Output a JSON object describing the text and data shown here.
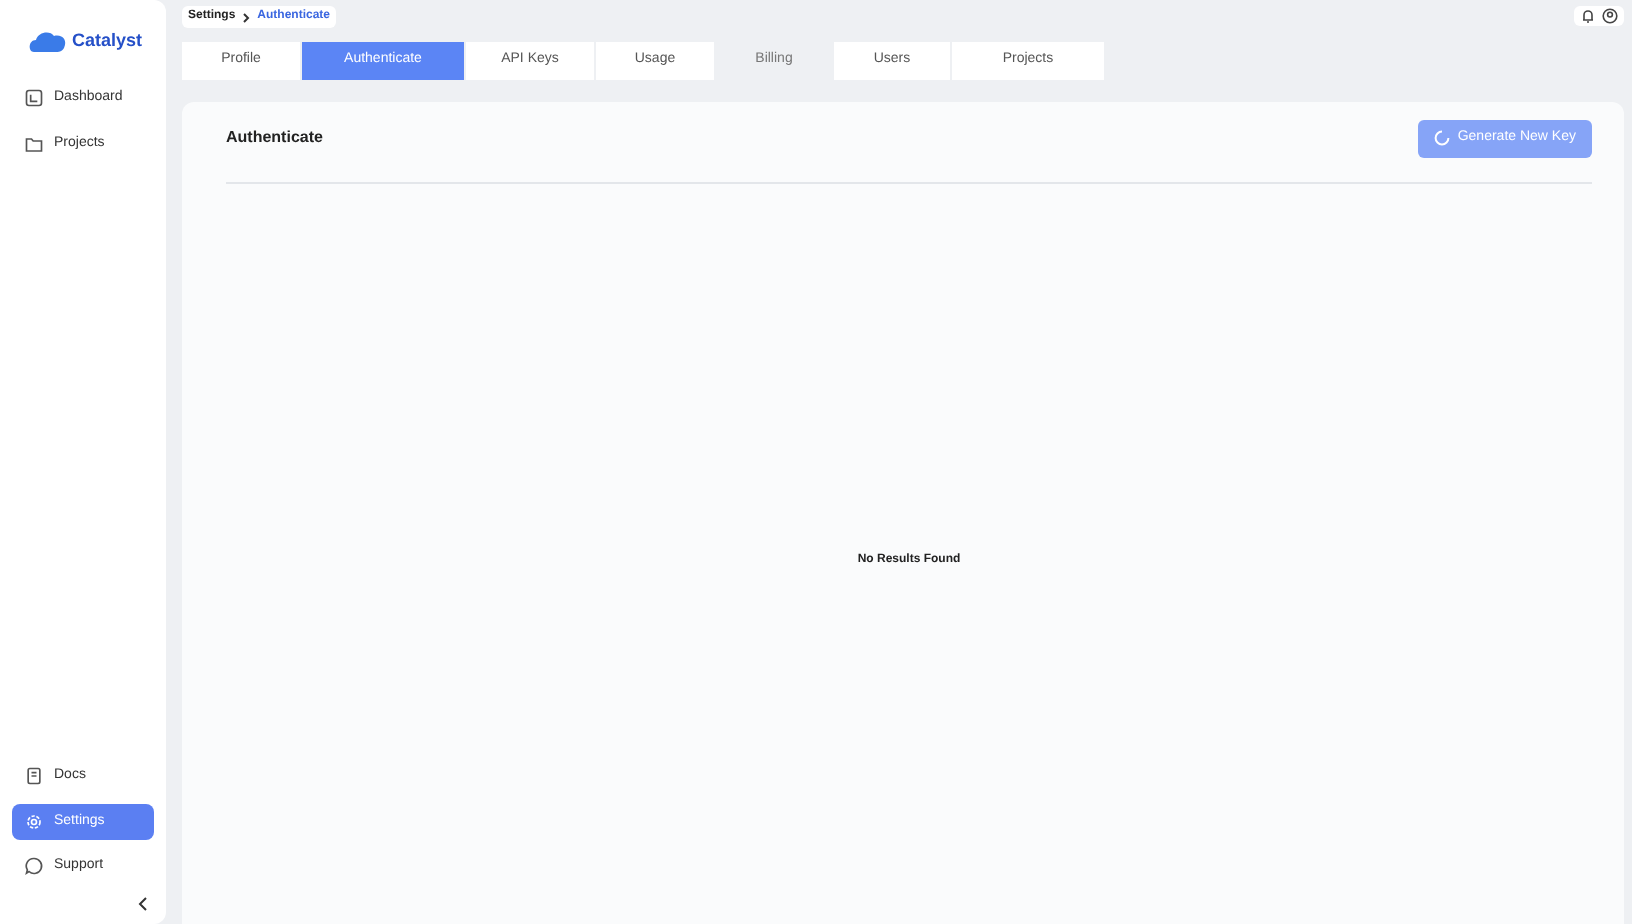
{
  "sidebar": {
    "logo": "Catalyst",
    "items": [
      {
        "label": "Dashboard",
        "kind": "dashboard",
        "selected": false
      },
      {
        "label": "Projects",
        "kind": "folder",
        "selected": false
      }
    ],
    "bottom_items": [
      {
        "label": "Docs",
        "kind": "doc",
        "selected": false
      },
      {
        "label": "Settings",
        "kind": "gear",
        "selected": true
      },
      {
        "label": "Support",
        "kind": "chat",
        "selected": false
      }
    ]
  },
  "breadcrumb": [
    "Settings",
    "Authenticate"
  ],
  "tabs": [
    {
      "label": "Profile",
      "selected": false,
      "disabled": false
    },
    {
      "label": "Authenticate",
      "selected": true,
      "disabled": false
    },
    {
      "label": "API Keys",
      "selected": false,
      "disabled": false
    },
    {
      "label": "Usage",
      "selected": false,
      "disabled": false
    },
    {
      "label": "Billing",
      "selected": false,
      "disabled": true
    },
    {
      "label": "Users",
      "selected": false,
      "disabled": false
    },
    {
      "label": "Projects",
      "selected": false,
      "disabled": false
    }
  ],
  "panel": {
    "title": "Authenticate",
    "button": {
      "label": "Generate New Key",
      "loading": true
    },
    "empty_text": "No Results Found"
  }
}
